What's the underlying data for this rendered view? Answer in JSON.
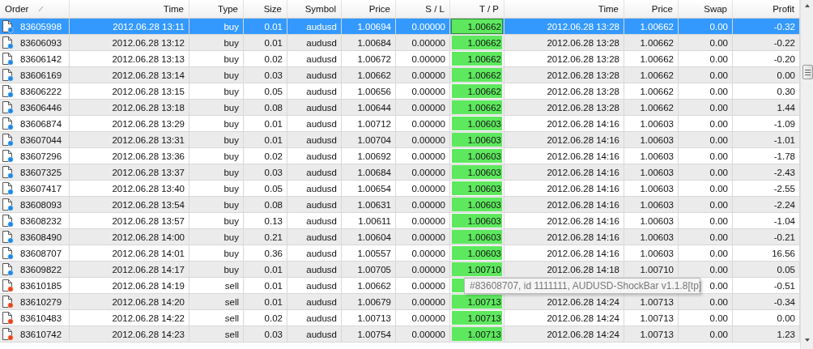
{
  "table": {
    "columns": [
      {
        "label": "Order",
        "sorted": true
      },
      {
        "label": "Time",
        "sorted": false
      },
      {
        "label": "Type",
        "sorted": false
      },
      {
        "label": "Size",
        "sorted": false
      },
      {
        "label": "Symbol",
        "sorted": false
      },
      {
        "label": "Price",
        "sorted": false
      },
      {
        "label": "S / L",
        "sorted": false
      },
      {
        "label": "T / P",
        "sorted": false
      },
      {
        "label": "Time",
        "sorted": false
      },
      {
        "label": "Price",
        "sorted": false
      },
      {
        "label": "Swap",
        "sorted": false
      },
      {
        "label": "Profit",
        "sorted": false
      }
    ],
    "rows": [
      {
        "kind": "buy",
        "selected": true,
        "order": "83605998",
        "open_time": "2012.06.28 13:11",
        "type": "buy",
        "size": "0.01",
        "symbol": "audusd",
        "open_price": "1.00694",
        "sl": "0.00000",
        "tp": "1.00662",
        "close_time": "2012.06.28 13:28",
        "close_price": "1.00662",
        "swap": "0.00",
        "profit": "-0.32"
      },
      {
        "kind": "buy",
        "selected": false,
        "order": "83606093",
        "open_time": "2012.06.28 13:12",
        "type": "buy",
        "size": "0.01",
        "symbol": "audusd",
        "open_price": "1.00684",
        "sl": "0.00000",
        "tp": "1.00662",
        "close_time": "2012.06.28 13:28",
        "close_price": "1.00662",
        "swap": "0.00",
        "profit": "-0.22"
      },
      {
        "kind": "buy",
        "selected": false,
        "order": "83606142",
        "open_time": "2012.06.28 13:13",
        "type": "buy",
        "size": "0.02",
        "symbol": "audusd",
        "open_price": "1.00672",
        "sl": "0.00000",
        "tp": "1.00662",
        "close_time": "2012.06.28 13:28",
        "close_price": "1.00662",
        "swap": "0.00",
        "profit": "-0.20"
      },
      {
        "kind": "buy",
        "selected": false,
        "order": "83606169",
        "open_time": "2012.06.28 13:14",
        "type": "buy",
        "size": "0.03",
        "symbol": "audusd",
        "open_price": "1.00662",
        "sl": "0.00000",
        "tp": "1.00662",
        "close_time": "2012.06.28 13:28",
        "close_price": "1.00662",
        "swap": "0.00",
        "profit": "0.00"
      },
      {
        "kind": "buy",
        "selected": false,
        "order": "83606222",
        "open_time": "2012.06.28 13:15",
        "type": "buy",
        "size": "0.05",
        "symbol": "audusd",
        "open_price": "1.00656",
        "sl": "0.00000",
        "tp": "1.00662",
        "close_time": "2012.06.28 13:28",
        "close_price": "1.00662",
        "swap": "0.00",
        "profit": "0.30"
      },
      {
        "kind": "buy",
        "selected": false,
        "order": "83606446",
        "open_time": "2012.06.28 13:18",
        "type": "buy",
        "size": "0.08",
        "symbol": "audusd",
        "open_price": "1.00644",
        "sl": "0.00000",
        "tp": "1.00662",
        "close_time": "2012.06.28 13:28",
        "close_price": "1.00662",
        "swap": "0.00",
        "profit": "1.44"
      },
      {
        "kind": "buy",
        "selected": false,
        "order": "83606874",
        "open_time": "2012.06.28 13:29",
        "type": "buy",
        "size": "0.01",
        "symbol": "audusd",
        "open_price": "1.00712",
        "sl": "0.00000",
        "tp": "1.00603",
        "close_time": "2012.06.28 14:16",
        "close_price": "1.00603",
        "swap": "0.00",
        "profit": "-1.09"
      },
      {
        "kind": "buy",
        "selected": false,
        "order": "83607044",
        "open_time": "2012.06.28 13:31",
        "type": "buy",
        "size": "0.01",
        "symbol": "audusd",
        "open_price": "1.00704",
        "sl": "0.00000",
        "tp": "1.00603",
        "close_time": "2012.06.28 14:16",
        "close_price": "1.00603",
        "swap": "0.00",
        "profit": "-1.01"
      },
      {
        "kind": "buy",
        "selected": false,
        "order": "83607296",
        "open_time": "2012.06.28 13:36",
        "type": "buy",
        "size": "0.02",
        "symbol": "audusd",
        "open_price": "1.00692",
        "sl": "0.00000",
        "tp": "1.00603",
        "close_time": "2012.06.28 14:16",
        "close_price": "1.00603",
        "swap": "0.00",
        "profit": "-1.78"
      },
      {
        "kind": "buy",
        "selected": false,
        "order": "83607325",
        "open_time": "2012.06.28 13:37",
        "type": "buy",
        "size": "0.03",
        "symbol": "audusd",
        "open_price": "1.00684",
        "sl": "0.00000",
        "tp": "1.00603",
        "close_time": "2012.06.28 14:16",
        "close_price": "1.00603",
        "swap": "0.00",
        "profit": "-2.43"
      },
      {
        "kind": "buy",
        "selected": false,
        "order": "83607417",
        "open_time": "2012.06.28 13:40",
        "type": "buy",
        "size": "0.05",
        "symbol": "audusd",
        "open_price": "1.00654",
        "sl": "0.00000",
        "tp": "1.00603",
        "close_time": "2012.06.28 14:16",
        "close_price": "1.00603",
        "swap": "0.00",
        "profit": "-2.55"
      },
      {
        "kind": "buy",
        "selected": false,
        "order": "83608093",
        "open_time": "2012.06.28 13:54",
        "type": "buy",
        "size": "0.08",
        "symbol": "audusd",
        "open_price": "1.00631",
        "sl": "0.00000",
        "tp": "1.00603",
        "close_time": "2012.06.28 14:16",
        "close_price": "1.00603",
        "swap": "0.00",
        "profit": "-2.24"
      },
      {
        "kind": "buy",
        "selected": false,
        "order": "83608232",
        "open_time": "2012.06.28 13:57",
        "type": "buy",
        "size": "0.13",
        "symbol": "audusd",
        "open_price": "1.00611",
        "sl": "0.00000",
        "tp": "1.00603",
        "close_time": "2012.06.28 14:16",
        "close_price": "1.00603",
        "swap": "0.00",
        "profit": "-1.04"
      },
      {
        "kind": "buy",
        "selected": false,
        "order": "83608490",
        "open_time": "2012.06.28 14:00",
        "type": "buy",
        "size": "0.21",
        "symbol": "audusd",
        "open_price": "1.00604",
        "sl": "0.00000",
        "tp": "1.00603",
        "close_time": "2012.06.28 14:16",
        "close_price": "1.00603",
        "swap": "0.00",
        "profit": "-0.21"
      },
      {
        "kind": "buy",
        "selected": false,
        "order": "83608707",
        "open_time": "2012.06.28 14:01",
        "type": "buy",
        "size": "0.36",
        "symbol": "audusd",
        "open_price": "1.00557",
        "sl": "0.00000",
        "tp": "1.00603",
        "close_time": "2012.06.28 14:16",
        "close_price": "1.00603",
        "swap": "0.00",
        "profit": "16.56"
      },
      {
        "kind": "buy",
        "selected": false,
        "order": "83609822",
        "open_time": "2012.06.28 14:17",
        "type": "buy",
        "size": "0.01",
        "symbol": "audusd",
        "open_price": "1.00705",
        "sl": "0.00000",
        "tp": "1.00710",
        "close_time": "2012.06.28 14:18",
        "close_price": "1.00710",
        "swap": "0.00",
        "profit": "0.05"
      },
      {
        "kind": "sell",
        "selected": false,
        "order": "83610185",
        "open_time": "2012.06.28 14:19",
        "type": "sell",
        "size": "0.01",
        "symbol": "audusd",
        "open_price": "1.00662",
        "sl": "0.00000",
        "swap": "0.00",
        "profit": "-0.51"
      },
      {
        "kind": "sell",
        "selected": false,
        "order": "83610279",
        "open_time": "2012.06.28 14:20",
        "type": "sell",
        "size": "0.01",
        "symbol": "audusd",
        "open_price": "1.00679",
        "sl": "0.00000",
        "tp": "1.00713",
        "close_time": "2012.06.28 14:24",
        "close_price": "1.00713",
        "swap": "0.00",
        "profit": "-0.34"
      },
      {
        "kind": "sell",
        "selected": false,
        "order": "83610483",
        "open_time": "2012.06.28 14:22",
        "type": "sell",
        "size": "0.02",
        "symbol": "audusd",
        "open_price": "1.00713",
        "sl": "0.00000",
        "tp": "1.00713",
        "close_time": "2012.06.28 14:24",
        "close_price": "1.00713",
        "swap": "0.00",
        "profit": "0.00"
      },
      {
        "kind": "sell",
        "selected": false,
        "order": "83610742",
        "open_time": "2012.06.28 14:23",
        "type": "sell",
        "size": "0.03",
        "symbol": "audusd",
        "open_price": "1.00754",
        "sl": "0.00000",
        "tp": "1.00713",
        "close_time": "2012.06.28 14:24",
        "close_price": "1.00713",
        "swap": "0.00",
        "profit": "1.23"
      }
    ]
  },
  "tooltip": {
    "text": "#83608707, id 1111111, AUDUSD-ShockBar v1.1.8[tp]"
  }
}
